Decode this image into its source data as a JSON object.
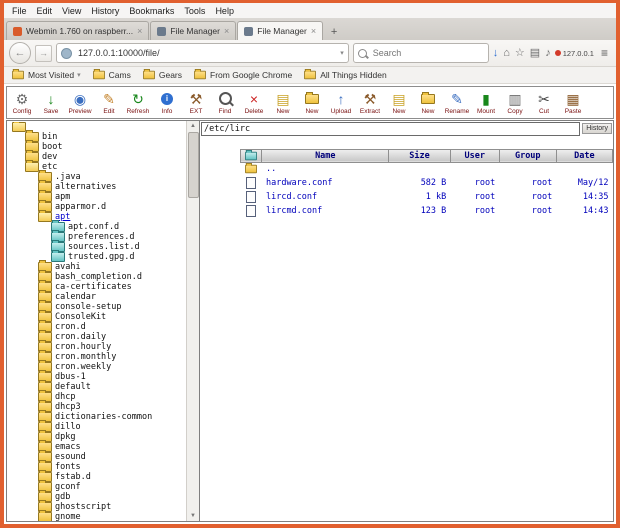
{
  "browser": {
    "menu": [
      "File",
      "Edit",
      "View",
      "History",
      "Bookmarks",
      "Tools",
      "Help"
    ],
    "tabs": [
      {
        "label": "Webmin 1.760 on raspberr...",
        "active": false,
        "favicon_color": "#d95b2b"
      },
      {
        "label": "File Manager",
        "active": false,
        "favicon_color": "#6b7a8c"
      },
      {
        "label": "File Manager",
        "active": true,
        "favicon_color": "#6b7a8c"
      }
    ],
    "new_tab_label": "+",
    "nav": {
      "back_glyph": "←",
      "forward_glyph": "→",
      "url": "127.0.0.1:10000/file/",
      "search_placeholder": "Search",
      "ip_indicator": "127.0.0.1",
      "icons": [
        "downloads",
        "home",
        "star",
        "bookmarks",
        "volume"
      ]
    },
    "bookmarks": [
      "Most Visited",
      "Cams",
      "Gears",
      "From Google Chrome",
      "All Things Hidden"
    ]
  },
  "filemanager": {
    "toolbar": [
      {
        "label": "Config",
        "icon": "config"
      },
      {
        "label": "Save",
        "icon": "save"
      },
      {
        "label": "Preview",
        "icon": "preview"
      },
      {
        "label": "Edit",
        "icon": "edit"
      },
      {
        "label": "Refresh",
        "icon": "refresh"
      },
      {
        "label": "Info",
        "icon": "info"
      },
      {
        "label": "EXT",
        "icon": "ext"
      },
      {
        "label": "Find",
        "icon": "find"
      },
      {
        "label": "Delete",
        "icon": "delete"
      },
      {
        "label": "New",
        "icon": "new"
      },
      {
        "label": "New",
        "icon": "newfolder"
      },
      {
        "label": "Upload",
        "icon": "upload"
      },
      {
        "label": "Extract",
        "icon": "extract"
      },
      {
        "label": "New",
        "icon": "new"
      },
      {
        "label": "New",
        "icon": "newfolder"
      },
      {
        "label": "Rename",
        "icon": "rename"
      },
      {
        "label": "Mount",
        "icon": "mount"
      },
      {
        "label": "Copy",
        "icon": "copy"
      },
      {
        "label": "Cut",
        "icon": "cut"
      },
      {
        "label": "Paste",
        "icon": "paste"
      }
    ],
    "path": "/etc/lirc",
    "history_label": "History",
    "table": {
      "headers": [
        "Name",
        "Size",
        "User",
        "Group",
        "Date"
      ],
      "rows": [
        {
          "icon": "folder",
          "name": "..",
          "size": "",
          "user": "",
          "group": "",
          "date": ""
        },
        {
          "icon": "file",
          "name": "hardware.conf",
          "size": "582 B",
          "user": "root",
          "group": "root",
          "date": "May/12"
        },
        {
          "icon": "file",
          "name": "lircd.conf",
          "size": "1 kB",
          "user": "root",
          "group": "root",
          "date": "14:35"
        },
        {
          "icon": "file",
          "name": "lircmd.conf",
          "size": "123 B",
          "user": "root",
          "group": "root",
          "date": "14:43"
        }
      ]
    },
    "tree": [
      {
        "label": "/",
        "depth": 0,
        "kind": "open"
      },
      {
        "label": "bin",
        "depth": 1,
        "kind": "folder"
      },
      {
        "label": "boot",
        "depth": 1,
        "kind": "folder"
      },
      {
        "label": "dev",
        "depth": 1,
        "kind": "folder"
      },
      {
        "label": "etc",
        "depth": 1,
        "kind": "open"
      },
      {
        "label": ".java",
        "depth": 2,
        "kind": "folder"
      },
      {
        "label": "alternatives",
        "depth": 2,
        "kind": "folder"
      },
      {
        "label": "apm",
        "depth": 2,
        "kind": "folder"
      },
      {
        "label": "apparmor.d",
        "depth": 2,
        "kind": "folder"
      },
      {
        "label": "apt",
        "depth": 2,
        "kind": "open",
        "selected": true
      },
      {
        "label": "apt.conf.d",
        "depth": 3,
        "kind": "teal"
      },
      {
        "label": "preferences.d",
        "depth": 3,
        "kind": "teal"
      },
      {
        "label": "sources.list.d",
        "depth": 3,
        "kind": "teal"
      },
      {
        "label": "trusted.gpg.d",
        "depth": 3,
        "kind": "teal"
      },
      {
        "label": "avahi",
        "depth": 2,
        "kind": "folder"
      },
      {
        "label": "bash_completion.d",
        "depth": 2,
        "kind": "folder"
      },
      {
        "label": "ca-certificates",
        "depth": 2,
        "kind": "folder"
      },
      {
        "label": "calendar",
        "depth": 2,
        "kind": "folder"
      },
      {
        "label": "console-setup",
        "depth": 2,
        "kind": "folder"
      },
      {
        "label": "ConsoleKit",
        "depth": 2,
        "kind": "folder"
      },
      {
        "label": "cron.d",
        "depth": 2,
        "kind": "folder"
      },
      {
        "label": "cron.daily",
        "depth": 2,
        "kind": "folder"
      },
      {
        "label": "cron.hourly",
        "depth": 2,
        "kind": "folder"
      },
      {
        "label": "cron.monthly",
        "depth": 2,
        "kind": "folder"
      },
      {
        "label": "cron.weekly",
        "depth": 2,
        "kind": "folder"
      },
      {
        "label": "dbus-1",
        "depth": 2,
        "kind": "folder"
      },
      {
        "label": "default",
        "depth": 2,
        "kind": "folder"
      },
      {
        "label": "dhcp",
        "depth": 2,
        "kind": "folder"
      },
      {
        "label": "dhcp3",
        "depth": 2,
        "kind": "folder"
      },
      {
        "label": "dictionaries-common",
        "depth": 2,
        "kind": "folder"
      },
      {
        "label": "dillo",
        "depth": 2,
        "kind": "folder"
      },
      {
        "label": "dpkg",
        "depth": 2,
        "kind": "folder"
      },
      {
        "label": "emacs",
        "depth": 2,
        "kind": "folder"
      },
      {
        "label": "esound",
        "depth": 2,
        "kind": "folder"
      },
      {
        "label": "fonts",
        "depth": 2,
        "kind": "folder"
      },
      {
        "label": "fstab.d",
        "depth": 2,
        "kind": "folder"
      },
      {
        "label": "gconf",
        "depth": 2,
        "kind": "folder"
      },
      {
        "label": "gdb",
        "depth": 2,
        "kind": "folder"
      },
      {
        "label": "ghostscript",
        "depth": 2,
        "kind": "folder"
      },
      {
        "label": "gnome",
        "depth": 2,
        "kind": "folder"
      }
    ]
  }
}
